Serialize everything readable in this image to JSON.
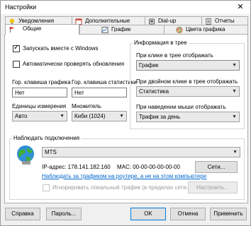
{
  "window": {
    "title": "Настройки"
  },
  "tabs": {
    "row_top": [
      "Уведомления",
      "Дополнительные",
      "Dial-up",
      "Отчеты"
    ],
    "row_bottom": [
      "Общие",
      "График",
      "Цвета графика"
    ]
  },
  "general": {
    "autostart_label": "Запускать вместе с Windows",
    "autostart_checked": true,
    "autoupdate_label": "Автоматически проверять обновления",
    "autoupdate_checked": false,
    "hotkey_graph_label": "Гор. клавиша графика",
    "hotkey_graph_value": "Нет",
    "hotkey_stats_label": "Гор. клавиша статистики",
    "hotkey_stats_value": "Нет",
    "units_label": "Единицы измерения",
    "units_value": "Авто",
    "multiplier_label": "Множитель",
    "multiplier_value": "Киби (1024)"
  },
  "tree_info": {
    "title": "Информация в трее",
    "click_label": "При клике в трее отображать",
    "click_value": "График",
    "dblclick_label": "При двойном клике в трее отображать",
    "dblclick_value": "Статистика",
    "hover_label": "При наведении мыши отображать",
    "hover_value": "Трафик за день"
  },
  "connection": {
    "title": "Наблюдать подключения",
    "selected": "MTS",
    "ip_text": "IP-адрес: 178.141.182.160",
    "mac_text": "MAC: 00-00-00-00-00-00",
    "networks_button": "Сети...",
    "router_link": "Наблюдать за трафиком на роутере, а не на этом компьютере",
    "ignore_local_label": "Игнорировать локальный трафик (в пределах сети...",
    "ignore_local_checked": false,
    "configure_button": "Настроить..."
  },
  "footer": {
    "help": "Справка",
    "password": "Пароль...",
    "ok": "OK",
    "cancel": "Отмена",
    "apply": "Применить"
  },
  "colors": {
    "link": "#0066cc",
    "default_border": "#0078d7"
  }
}
